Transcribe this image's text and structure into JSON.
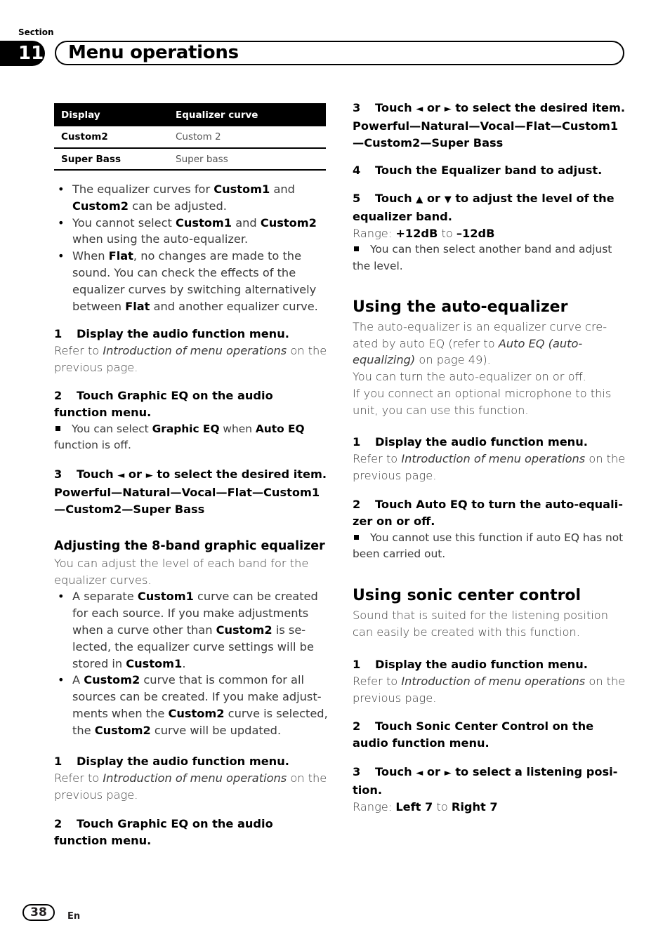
{
  "header": {
    "section_label": "Section",
    "section_number": "11",
    "title": "Menu operations"
  },
  "table": {
    "headers": [
      "Display",
      "Equalizer curve"
    ],
    "rows": [
      [
        "Custom2",
        "Custom 2"
      ],
      [
        "Super Bass",
        "Super bass"
      ]
    ]
  },
  "left": {
    "bullets1": [
      {
        "a": "The equalizer curves for ",
        "b1": "Custom1",
        "c": " and ",
        "b2": "Custom2",
        "d": " can be adjusted."
      },
      {
        "a": "You cannot select ",
        "b1": "Custom1",
        "c": " and ",
        "b2": "Custom2",
        "d": " when using the auto-equalizer."
      },
      {
        "a": "When ",
        "b1": "Flat",
        "c": ", no changes are made to the sound. You can check the effects of the equalizer curves by switching alternatively between ",
        "b2": "Flat",
        "d": " and another equalizer curve."
      }
    ],
    "step1": {
      "num": "1",
      "text": "Display the audio function menu."
    },
    "step1_ref": {
      "a": "Refer to ",
      "i": "Introduction of menu operations",
      "b": " on the previous page."
    },
    "step2": {
      "num": "2",
      "text": "Touch Graphic EQ on the audio function menu."
    },
    "step2_note": {
      "a": "You can select ",
      "b1": "Graphic EQ",
      "c": " when ",
      "b2": "Auto EQ",
      "d": " function is off."
    },
    "step3": {
      "num": "3",
      "pre": "Touch ",
      "left_arrow": "◄",
      "or": " or ",
      "right_arrow": "►",
      "post": " to select the desired item."
    },
    "step3_items": "Powerful—Natural—Vocal—Flat—Custom1—Custom2—Super Bass",
    "subheading": "Adjusting the 8-band graphic equalizer",
    "sub_intro": "You can adjust the level of each band for the equalizer curves.",
    "bullets2": [
      {
        "a": "A separate ",
        "b1": "Custom1",
        "c": " curve can be created for each source. If you make adjustments when a curve other than ",
        "b2": "Custom2",
        "d": " is se­lected, the equalizer curve settings will be stored in ",
        "b3": "Custom1",
        "e": "."
      },
      {
        "a": "A ",
        "b1": "Custom2",
        "c": " curve that is common for all sources can be created. If you make adjust­ments when the ",
        "b2": "Custom2",
        "d": " curve is se­lected, the ",
        "b3": "Custom2",
        "e": " curve will be updated."
      }
    ],
    "step4": {
      "num": "1",
      "text": "Display the audio function menu."
    },
    "step4_ref": {
      "a": "Refer to ",
      "i": "Introduction of menu operations",
      "b": " on the previous page."
    },
    "step5": {
      "num": "2",
      "text": "Touch Graphic EQ on the audio function menu."
    }
  },
  "right": {
    "step3": {
      "num": "3",
      "pre": "Touch ",
      "left_arrow": "◄",
      "or": " or ",
      "right_arrow": "►",
      "post": " to select the desired item."
    },
    "step3_items": "Powerful—Natural—Vocal—Flat—Custom1—Custom2—Super Bass",
    "step4": {
      "num": "4",
      "text": "Touch the Equalizer band to adjust."
    },
    "step5": {
      "num": "5",
      "pre": "Touch ",
      "up_arrow": "▲",
      "or": " or ",
      "down_arrow": "▼",
      "post": " to adjust the level of the equalizer band."
    },
    "step5_range": {
      "label": "Range: ",
      "from": "+12dB",
      "to_word": " to ",
      "to": "–12dB"
    },
    "step5_note": "You can then select another band and adjust the level.",
    "auto_eq": {
      "heading": "Using the auto-equalizer",
      "intro_a": "The auto-equalizer is an equalizer curve cre­ated by auto EQ (refer to ",
      "intro_i": "Auto EQ (auto-equaliz­ing)",
      "intro_b": " on page 49).",
      "line2": "You can turn the auto-equalizer on or off.",
      "line3": "If you connect an optional microphone to this unit, you can use this function.",
      "step1": {
        "num": "1",
        "text": "Display the audio function menu."
      },
      "step1_ref": {
        "a": "Refer to ",
        "i": "Introduction of menu operations",
        "b": " on the previous page."
      },
      "step2": {
        "num": "2",
        "text": "Touch Auto EQ to turn the auto-equali­zer on or off."
      },
      "step2_note": "You cannot use this function if auto EQ has not been carried out."
    },
    "sonic": {
      "heading": "Using sonic center control",
      "intro": "Sound that is suited for the listening position can easily be created with this function.",
      "step1": {
        "num": "1",
        "text": "Display the audio function menu."
      },
      "step1_ref": {
        "a": "Refer to ",
        "i": "Introduction of menu operations",
        "b": " on the previous page."
      },
      "step2": {
        "num": "2",
        "text": "Touch Sonic Center Control on the audio function menu."
      },
      "step3": {
        "num": "3",
        "pre": "Touch ",
        "left_arrow": "◄",
        "or": " or ",
        "right_arrow": "►",
        "post": " to select a listening posi­tion."
      },
      "step3_range": {
        "label": "Range: ",
        "from": "Left 7",
        "to_word": " to ",
        "to": "Right 7"
      }
    }
  },
  "footer": {
    "page_number": "38",
    "language": "En"
  }
}
